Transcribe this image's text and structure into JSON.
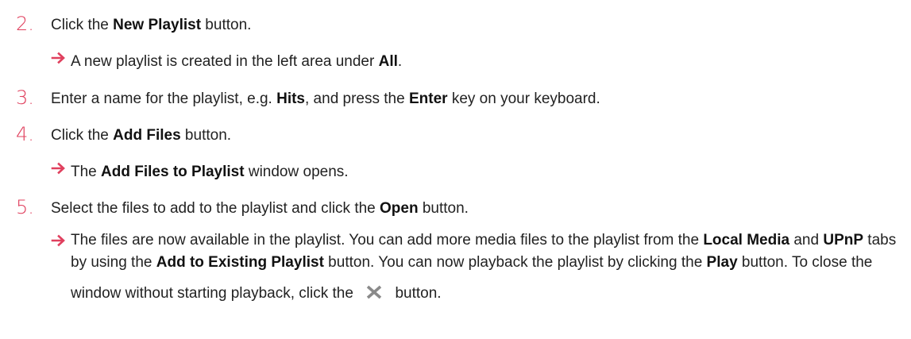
{
  "steps": [
    {
      "number": "2.",
      "text_before": "Click the ",
      "bold": "New Playlist",
      "text_after": " button.",
      "result": {
        "text_before": "A new playlist is created in the left area under ",
        "bold": "All",
        "text_after": "."
      }
    },
    {
      "number": "3.",
      "text_before": "Enter a name for the playlist, e.g. ",
      "bold": "Hits",
      "text_mid": ", and press the ",
      "bold2": "Enter",
      "text_after": " key on your keyboard."
    },
    {
      "number": "4.",
      "text_before": "Click the ",
      "bold": "Add Files",
      "text_after": " button.",
      "result": {
        "text_before": "The ",
        "bold": "Add Files to Playlist",
        "text_after": " window opens."
      }
    },
    {
      "number": "5.",
      "text_before": "Select the files to add to the playlist and click the ",
      "bold": "Open",
      "text_after": " button.",
      "result": {
        "p1": "The files are now available in the playlist. You can add more media files to the playlist from the ",
        "b1": "Local Media",
        "p2": " and ",
        "b2": "UPnP",
        "p3": " tabs by using the ",
        "b3": "Add to Existing Playlist",
        "p4": " button. You can now playback the playlist by clicking the ",
        "b4": "Play",
        "p5": " button. To close the window without starting playback, click the ",
        "icon": "close-x-icon",
        "p6": " button."
      }
    }
  ],
  "colors": {
    "accent": "#e0405e",
    "text": "#222222",
    "icon": "#8a8a8a"
  }
}
